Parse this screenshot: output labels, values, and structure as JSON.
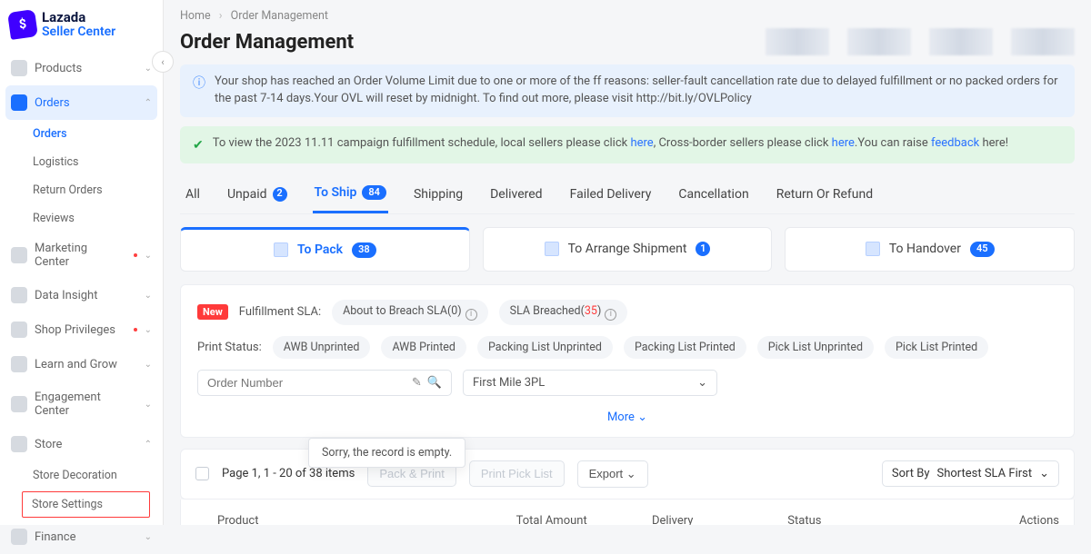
{
  "brand": {
    "line1": "Lazada",
    "line2": "Seller Center"
  },
  "sidebar": {
    "products": "Products",
    "orders": "Orders",
    "orders_sub": "Orders",
    "logistics": "Logistics",
    "return_orders": "Return Orders",
    "reviews": "Reviews",
    "marketing": "Marketing Center",
    "data_insight": "Data Insight",
    "shop_priv": "Shop Privileges",
    "learn": "Learn and Grow",
    "engagement": "Engagement Center",
    "store": "Store",
    "store_decor": "Store Decoration",
    "store_settings": "Store Settings",
    "finance": "Finance"
  },
  "crumbs": {
    "home": "Home",
    "om": "Order Management"
  },
  "title": "Order Management",
  "alerts": {
    "info": "Your shop has reached an Order Volume Limit due to one or more of the ff reasons: seller-fault cancellation rate due to delayed fulfillment or no packed orders for the past 7-14 days.Your OVL will reset by midnight. To find out more, please visit http://bit.ly/OVLPolicy",
    "success_pre": "To view the 2023 11.11 campaign fulfillment schedule, local sellers please click ",
    "success_link1": "here",
    "success_mid": ", Cross-border sellers please click ",
    "success_link2": "here",
    "success_mid2": ".You can raise ",
    "success_link3": "feedback",
    "success_post": " here!"
  },
  "tabs": {
    "all": "All",
    "unpaid": "Unpaid",
    "unpaid_badge": "2",
    "to_ship": "To Ship",
    "to_ship_badge": "84",
    "shipping": "Shipping",
    "delivered": "Delivered",
    "failed": "Failed Delivery",
    "cancel": "Cancellation",
    "return": "Return Or Refund"
  },
  "segments": {
    "to_pack": "To Pack",
    "to_pack_badge": "38",
    "arrange": "To Arrange Shipment",
    "arrange_badge": "1",
    "handover": "To Handover",
    "handover_badge": "45"
  },
  "filters": {
    "new": "New",
    "sla_label": "Fulfillment SLA:",
    "about_to_breach": "About to Breach SLA(0)",
    "sla_breached_pre": "SLA Breached(",
    "sla_breached_num": "35",
    "sla_breached_post": ")",
    "print_status": "Print Status:",
    "chips": {
      "awb_un": "AWB Unprinted",
      "awb_p": "AWB Printed",
      "pl_un": "Packing List Unprinted",
      "pl_p": "Packing List Printed",
      "pick_un": "Pick List Unprinted",
      "pick_p": "Pick List Printed"
    },
    "order_num_placeholder": "Order Number",
    "first_mile": "First Mile 3PL",
    "more": "More",
    "popover": "Sorry, the record is empty."
  },
  "actionbar": {
    "page_text": "Page 1, 1 - 20 of 38 items",
    "pack_print": "Pack & Print",
    "print_pick": "Print Pick List",
    "export": "Export",
    "sort_by": "Sort By",
    "sort_value": "Shortest SLA First"
  },
  "table": {
    "product": "Product",
    "total": "Total Amount",
    "delivery": "Delivery",
    "status": "Status",
    "actions": "Actions"
  }
}
